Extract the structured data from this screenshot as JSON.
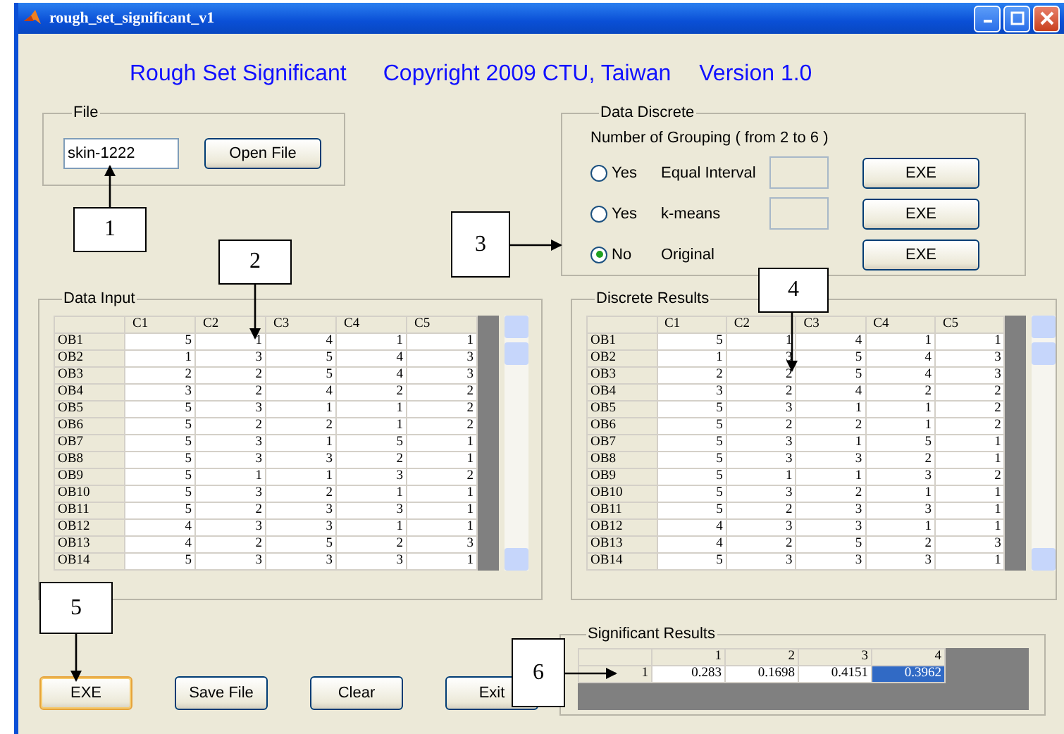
{
  "window": {
    "title": "rough_set_significant_v1"
  },
  "heading": [
    "Rough Set Significant",
    "Copyright 2009 CTU, Taiwan",
    "Version 1.0"
  ],
  "file": {
    "title": "File",
    "value": "skin-1222",
    "button": "Open File"
  },
  "discrete": {
    "title": "Data Discrete",
    "hint": "Number of Grouping ( from 2 to 6 )",
    "options": [
      {
        "kind": "count",
        "label": "Yes",
        "method": "Equal Interval",
        "selected": false,
        "button": "EXE"
      },
      {
        "kind": "count",
        "label": "Yes",
        "method": "k-means",
        "selected": false,
        "button": "EXE"
      },
      {
        "kind": "fixed",
        "label": "No",
        "method": "Original",
        "selected": true,
        "button": "EXE"
      }
    ]
  },
  "tables": [
    {
      "title": "Data Input",
      "columns": [
        "C1",
        "C2",
        "C3",
        "C4",
        "C5"
      ],
      "rows": [
        {
          "label": "OB1",
          "cells": [
            "5",
            "1",
            "4",
            "1",
            "1"
          ]
        },
        {
          "label": "OB2",
          "cells": [
            "1",
            "3",
            "5",
            "4",
            "3"
          ]
        },
        {
          "label": "OB3",
          "cells": [
            "2",
            "2",
            "5",
            "4",
            "3"
          ]
        },
        {
          "label": "OB4",
          "cells": [
            "3",
            "2",
            "4",
            "2",
            "2"
          ]
        },
        {
          "label": "OB5",
          "cells": [
            "5",
            "3",
            "1",
            "1",
            "2"
          ]
        },
        {
          "label": "OB6",
          "cells": [
            "5",
            "2",
            "2",
            "1",
            "2"
          ]
        },
        {
          "label": "OB7",
          "cells": [
            "5",
            "3",
            "1",
            "5",
            "1"
          ]
        },
        {
          "label": "OB8",
          "cells": [
            "5",
            "3",
            "3",
            "2",
            "1"
          ]
        },
        {
          "label": "OB9",
          "cells": [
            "5",
            "1",
            "1",
            "3",
            "2"
          ]
        },
        {
          "label": "OB10",
          "cells": [
            "5",
            "3",
            "2",
            "1",
            "1"
          ]
        },
        {
          "label": "OB11",
          "cells": [
            "5",
            "2",
            "3",
            "3",
            "1"
          ]
        },
        {
          "label": "OB12",
          "cells": [
            "4",
            "3",
            "3",
            "1",
            "1"
          ]
        },
        {
          "label": "OB13",
          "cells": [
            "4",
            "2",
            "5",
            "2",
            "3"
          ]
        },
        {
          "label": "OB14",
          "cells": [
            "5",
            "3",
            "3",
            "3",
            "1"
          ]
        }
      ]
    },
    {
      "title": "Discrete Results",
      "columns": [
        "C1",
        "C2",
        "C3",
        "C4",
        "C5"
      ],
      "rows": [
        {
          "label": "OB1",
          "cells": [
            "5",
            "1",
            "4",
            "1",
            "1"
          ]
        },
        {
          "label": "OB2",
          "cells": [
            "1",
            "3",
            "5",
            "4",
            "3"
          ]
        },
        {
          "label": "OB3",
          "cells": [
            "2",
            "2",
            "5",
            "4",
            "3"
          ]
        },
        {
          "label": "OB4",
          "cells": [
            "3",
            "2",
            "4",
            "2",
            "2"
          ]
        },
        {
          "label": "OB5",
          "cells": [
            "5",
            "3",
            "1",
            "1",
            "2"
          ]
        },
        {
          "label": "OB6",
          "cells": [
            "5",
            "2",
            "2",
            "1",
            "2"
          ]
        },
        {
          "label": "OB7",
          "cells": [
            "5",
            "3",
            "1",
            "5",
            "1"
          ]
        },
        {
          "label": "OB8",
          "cells": [
            "5",
            "3",
            "3",
            "2",
            "1"
          ]
        },
        {
          "label": "OB9",
          "cells": [
            "5",
            "1",
            "1",
            "3",
            "2"
          ]
        },
        {
          "label": "OB10",
          "cells": [
            "5",
            "3",
            "2",
            "1",
            "1"
          ]
        },
        {
          "label": "OB11",
          "cells": [
            "5",
            "2",
            "3",
            "3",
            "1"
          ]
        },
        {
          "label": "OB12",
          "cells": [
            "4",
            "3",
            "3",
            "1",
            "1"
          ]
        },
        {
          "label": "OB13",
          "cells": [
            "4",
            "2",
            "5",
            "2",
            "3"
          ]
        },
        {
          "label": "OB14",
          "cells": [
            "5",
            "3",
            "3",
            "3",
            "1"
          ]
        }
      ]
    }
  ],
  "buttons": [
    {
      "label": "EXE",
      "focused": true
    },
    {
      "label": "Save File",
      "focused": false
    },
    {
      "label": "Clear",
      "focused": false
    },
    {
      "label": "Exit",
      "focused": false
    }
  ],
  "significant": {
    "title": "Significant Results",
    "columns": [
      "1",
      "2",
      "3",
      "4"
    ],
    "rows": [
      {
        "label": "1",
        "cells": [
          {
            "value": "0.283",
            "selected": false
          },
          {
            "value": "0.1698",
            "selected": false
          },
          {
            "value": "0.4151",
            "selected": false
          },
          {
            "value": "0.3962",
            "selected": true
          }
        ]
      }
    ]
  },
  "callouts": [
    {
      "label": "1"
    },
    {
      "label": "2"
    },
    {
      "label": "3"
    },
    {
      "label": "4"
    },
    {
      "label": "5"
    },
    {
      "label": "6"
    }
  ]
}
